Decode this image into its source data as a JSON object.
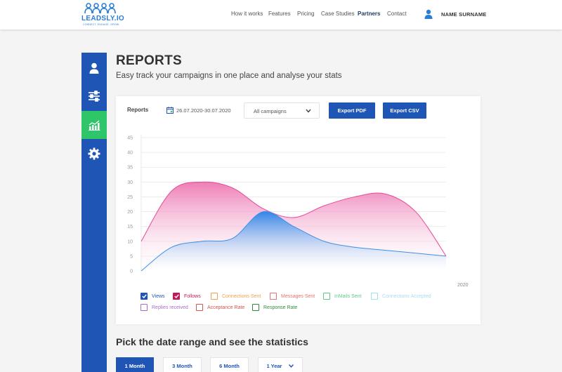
{
  "brand": {
    "name": "LEADSLY.IO",
    "tagline": "CONNECT. ENGAGE. GROW."
  },
  "nav": [
    {
      "label": "How it works",
      "active": false
    },
    {
      "label": "Features",
      "active": false
    },
    {
      "label": "Pricing",
      "active": false
    },
    {
      "label": "Case Studies",
      "active": false
    },
    {
      "label": "Partners",
      "active": true
    },
    {
      "label": "Contact",
      "active": false
    }
  ],
  "user": {
    "name": "NAME SURNAME"
  },
  "sidebar": {
    "items": [
      {
        "icon": "user-icon",
        "active": false
      },
      {
        "icon": "sliders-icon",
        "active": false
      },
      {
        "icon": "chart-icon",
        "active": true
      },
      {
        "icon": "gear-icon",
        "active": false
      }
    ]
  },
  "page": {
    "title": "REPORTS",
    "subtitle": "Easy track your campaigns in one place and analyse your stats"
  },
  "card": {
    "label": "Reports",
    "date_range": "26.07.2020-30.07.2020",
    "campaign_select": "All campaigns",
    "export_pdf": "Export PDF",
    "export_csv": "Export CSV"
  },
  "chart_data": {
    "type": "area",
    "x": [
      0,
      1,
      2,
      3,
      4,
      5,
      6,
      7,
      8,
      9,
      10
    ],
    "xlabel": "2020",
    "ylim": [
      0,
      45
    ],
    "yticks": [
      0,
      5,
      10,
      15,
      20,
      25,
      30,
      35,
      40,
      45
    ],
    "grid": true,
    "series": [
      {
        "name": "Follows",
        "color": "#e8489a",
        "values": [
          10,
          27,
          30,
          28,
          21,
          18,
          22,
          25,
          26,
          20,
          5
        ]
      },
      {
        "name": "Views",
        "color": "#3e90e6",
        "values": [
          0,
          8,
          10,
          11,
          20,
          15,
          10,
          8,
          7,
          6,
          5
        ]
      }
    ]
  },
  "legend": [
    {
      "label": "Views",
      "color": "#1f55b5",
      "checked": true
    },
    {
      "label": "Follows",
      "color": "#c2185b",
      "checked": true
    },
    {
      "label": "Connections Sent",
      "color": "#f5a04a",
      "checked": false
    },
    {
      "label": "Messages Sent",
      "color": "#e57373",
      "checked": false
    },
    {
      "label": "InMails Sent",
      "color": "#5cc98a",
      "checked": false
    },
    {
      "label": "Connections Accepted",
      "color": "#a6dcef",
      "checked": false
    },
    {
      "label": "Replies received",
      "color": "#a46fc7",
      "checked": false
    },
    {
      "label": "Acceptance Rate",
      "color": "#d9534f",
      "checked": false
    },
    {
      "label": "Response Rate",
      "color": "#2e8b3e",
      "checked": false
    }
  ],
  "range": {
    "title": "Pick the date range and see the statistics",
    "buttons": [
      {
        "label": "1 Month",
        "active": true
      },
      {
        "label": "3 Month",
        "active": false
      },
      {
        "label": "6 Month",
        "active": false
      }
    ],
    "select": "1 Year"
  }
}
